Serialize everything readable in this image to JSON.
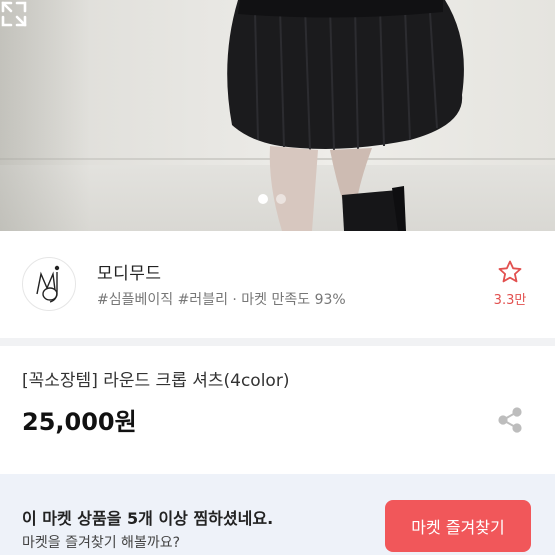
{
  "product_image": {
    "dots": [
      {
        "active": true
      },
      {
        "active": false
      }
    ]
  },
  "shop": {
    "name": "모디무드",
    "meta": "#심플베이직 #러블리 · 마켓 만족도 93%",
    "fav_count": "3.3만",
    "colors": {
      "accent": "#e2504f"
    }
  },
  "product": {
    "title": "[꼭소장템] 라운드 크롭 셔츠(4color)",
    "price": "25,000원"
  },
  "banner": {
    "line1": "이 마켓 상품을 5개 이상 찜하셨네요.",
    "line2": "마켓을 즐겨찾기 해볼까요?",
    "button_label": "마켓 즐겨찾기",
    "colors": {
      "button": "#f1575a",
      "background": "#eef2f9"
    }
  }
}
